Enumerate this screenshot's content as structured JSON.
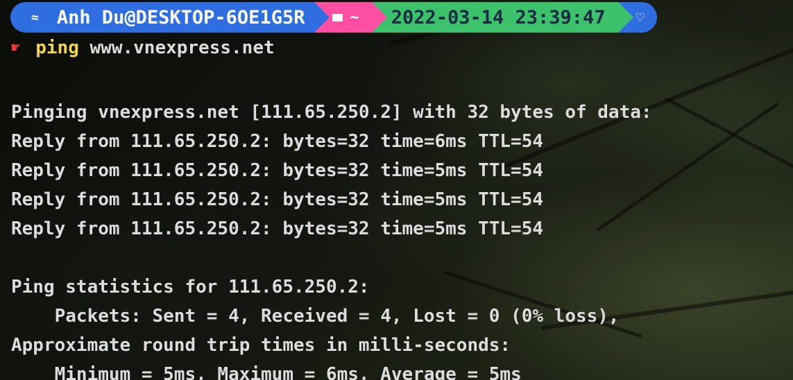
{
  "prompt": {
    "user_host": "Anh Du@DESKTOP-6OE1G5R",
    "path": "~",
    "datetime": "2022-03-14 23:39:47",
    "os_icon": "windows-icon",
    "folder_icon": "folder-icon",
    "end_icon": "heart-icon",
    "colors": {
      "user_segment": "#2f6ee0",
      "path_segment": "#ff4fa3",
      "time_segment": "#3cc26a",
      "command": "#f2d64a",
      "prompt_arrow": "#e83a3a"
    }
  },
  "command": {
    "name": "ping",
    "args": " www.vnexpress.net"
  },
  "output": {
    "lines": [
      "Pinging vnexpress.net [111.65.250.2] with 32 bytes of data:",
      "Reply from 111.65.250.2: bytes=32 time=6ms TTL=54",
      "Reply from 111.65.250.2: bytes=32 time=5ms TTL=54",
      "Reply from 111.65.250.2: bytes=32 time=5ms TTL=54",
      "Reply from 111.65.250.2: bytes=32 time=5ms TTL=54",
      "",
      "Ping statistics for 111.65.250.2:",
      "    Packets: Sent = 4, Received = 4, Lost = 0 (0% loss),",
      "Approximate round trip times in milli-seconds:",
      "    Minimum = 5ms, Maximum = 6ms, Average = 5ms"
    ]
  }
}
